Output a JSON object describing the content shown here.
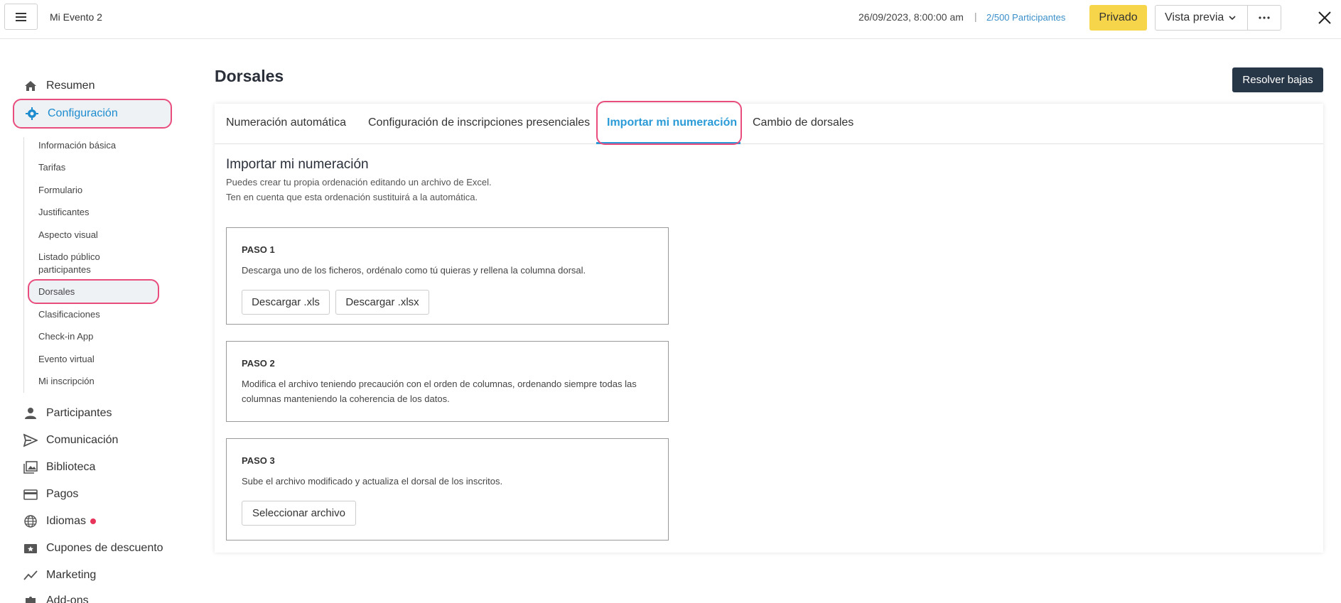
{
  "header": {
    "app_title": "Mi Evento 2",
    "datetime": "26/09/2023, 8:00:00 am",
    "separator": "|",
    "participants_count": "2",
    "participants_total": "/500",
    "participants_label": "Participantes",
    "privacy_label": "Privado",
    "preview_label": "Vista previa",
    "icons": [
      "menu-icon",
      "chevron-down-icon",
      "more-icon",
      "close-icon"
    ]
  },
  "sidebar": {
    "resumen": "Resumen",
    "configuracion": "Configuración",
    "sub_items": [
      "Información básica",
      "Tarifas",
      "Formulario",
      "Justificantes",
      "Aspecto visual",
      "Listado público",
      "participantes",
      "Dorsales",
      "Clasificaciones",
      "Check-in App",
      "Evento virtual",
      "Mi inscripción"
    ],
    "items": [
      "Participantes",
      "Comunicación",
      "Biblioteca",
      "Pagos",
      "Idiomas",
      "Cupones de descuento",
      "Marketing",
      "Add-ons"
    ]
  },
  "main": {
    "page_title": "Dorsales",
    "resolve_button": "Resolver bajas",
    "tabs": [
      "Numeración automática",
      "Configuración de inscripciones presenciales",
      "Importar mi numeración",
      "Cambio de dorsales"
    ],
    "active_tab": "Importar mi numeración",
    "section_title": "Importar mi numeración",
    "section_desc_1": "Puedes crear tu propia ordenación editando un archivo de Excel.",
    "section_desc_2": "Ten en cuenta que esta ordenación sustituirá a la automática.",
    "steps": [
      {
        "title": "PASO 1",
        "text": "Descarga uno de los ficheros, ordénalo como tú quieras y rellena la columna dorsal.",
        "buttons": [
          "Descargar .xls",
          "Descargar .xlsx"
        ]
      },
      {
        "title": "PASO 2",
        "text_1": "Modifica el archivo teniendo precaución con el orden de columnas, ordenando siempre todas las",
        "text_2": "columnas manteniendo la coherencia de los datos."
      },
      {
        "title": "PASO 3",
        "text": "Sube el archivo modificado y actualiza el dorsal de los inscritos.",
        "buttons": [
          "Seleccionar archivo"
        ]
      }
    ]
  },
  "colors": {
    "accent": "#2a9bd6",
    "highlight": "#e84d7d",
    "privado": "#f7d54a",
    "dark_button": "#283747"
  }
}
